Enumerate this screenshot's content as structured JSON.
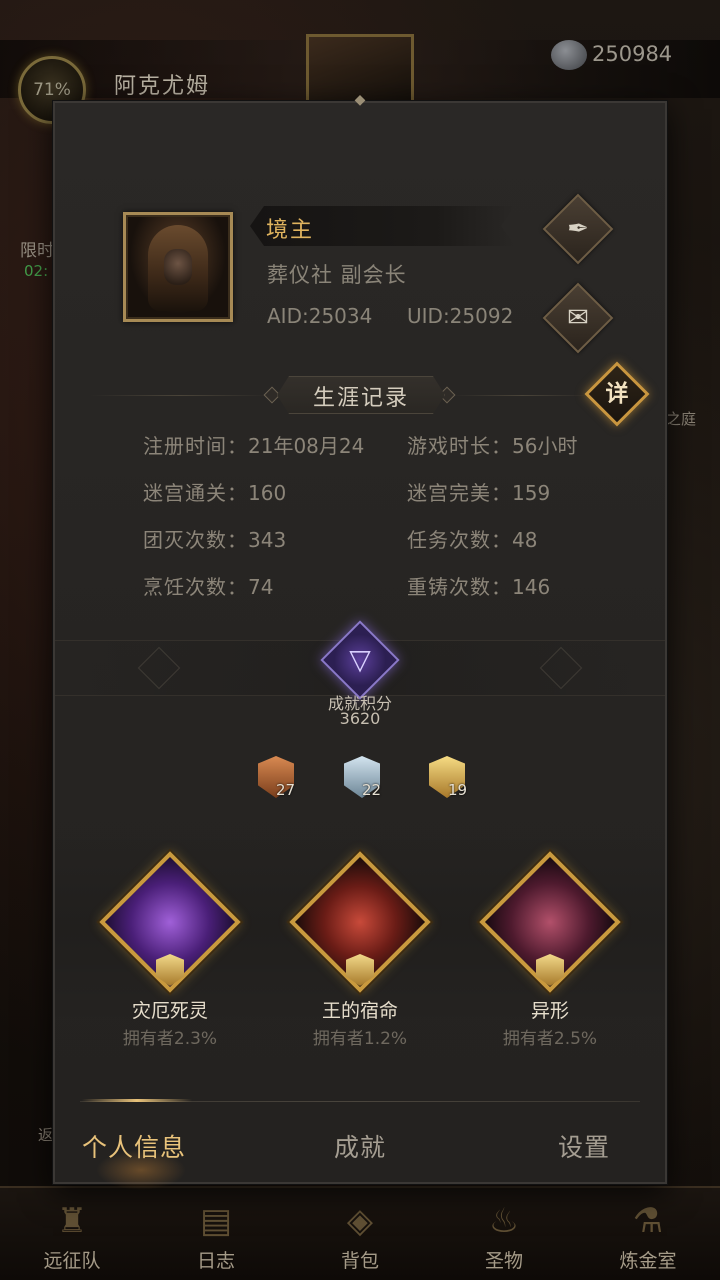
{
  "header": {
    "level_percent": "71%",
    "player_name": "阿克尤姆",
    "currency_value": "250984"
  },
  "side_labels": {
    "left_event": "限时",
    "left_timer": "02:",
    "right_area": "之庭",
    "left_bottom": "返"
  },
  "profile": {
    "rank_title": "境主",
    "guild_role": "葬仪社 副会长",
    "aid": "AID:25034",
    "uid": "UID:25092",
    "edit_icon": "quill-icon",
    "notes_icon": "scroll-icon"
  },
  "career": {
    "title": "生涯记录",
    "detail_label": "详",
    "stats": [
      {
        "label": "注册时间：",
        "value": "21年08月24"
      },
      {
        "label": "游戏时长：",
        "value": "56小时"
      },
      {
        "label": "迷宫通关：",
        "value": "160"
      },
      {
        "label": "迷宫完美：",
        "value": "159"
      },
      {
        "label": "团灭次数：",
        "value": "343"
      },
      {
        "label": "任务次数：",
        "value": "48"
      },
      {
        "label": "烹饪次数：",
        "value": "74"
      },
      {
        "label": "重铸次数：",
        "value": "146"
      }
    ]
  },
  "achievement_score": {
    "label": "成就积分",
    "value": "3620"
  },
  "medals": [
    {
      "tier": "bronze",
      "count": "27",
      "color": "#b86b3a"
    },
    {
      "tier": "silver",
      "count": "22",
      "color": "#9db4c4"
    },
    {
      "tier": "gold",
      "count": "19",
      "color": "#e0b24a"
    }
  ],
  "featured": [
    {
      "name": "灾厄死灵",
      "owners": "拥有者2.3%",
      "color": "#7a3fb0"
    },
    {
      "name": "王的宿命",
      "owners": "拥有者1.2%",
      "color": "#b23a2e"
    },
    {
      "name": "异形",
      "owners": "拥有者2.5%",
      "color": "#a03a50"
    }
  ],
  "tabs": [
    {
      "label": "个人信息",
      "active": true
    },
    {
      "label": "成就",
      "active": false
    },
    {
      "label": "设置",
      "active": false
    }
  ],
  "bottom_nav": [
    {
      "label": "远征队",
      "icon": "helmet-icon"
    },
    {
      "label": "日志",
      "icon": "book-icon"
    },
    {
      "label": "背包",
      "icon": "bag-icon"
    },
    {
      "label": "圣物",
      "icon": "torch-icon"
    },
    {
      "label": "炼金室",
      "icon": "alchemy-icon"
    }
  ],
  "colors": {
    "accent_gold": "#e0b45e",
    "panel_bg": "#282624",
    "active_tab": "#e8c27a"
  }
}
